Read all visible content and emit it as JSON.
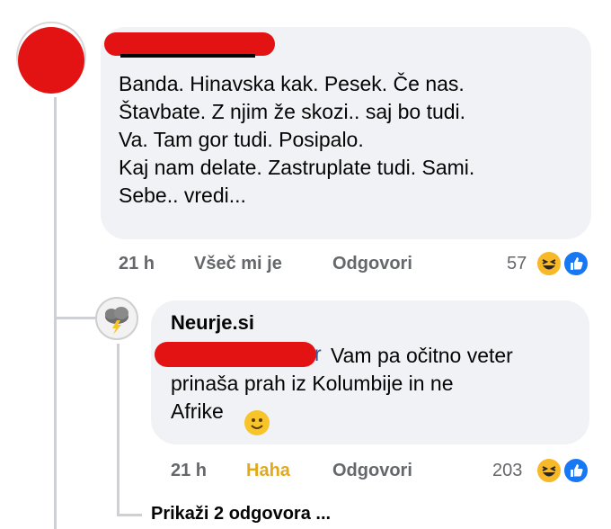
{
  "comment": {
    "text": "Banda. Hinavska kak. Pesek. Če nas.\nŠtavbate. Z njim že skozi.. saj bo tudi.\nVa. Tam gor tudi. Posipalo.\n Kaj nam delate.  Zastruplate tudi. Sami.\nSebe..  vredi...",
    "time": "21 h",
    "like_label": "Všeč mi je",
    "reply_label": "Odgovori",
    "reaction_count": "57",
    "reaction_icons": [
      "haha-icon",
      "like-icon"
    ]
  },
  "reply": {
    "author": "Neurje.si",
    "mention_tail": "r",
    "text": "Vam pa očitno veter\nprinaša prah iz Kolumbije in ne\nAfrike",
    "time": "21 h",
    "reaction_label": "Haha",
    "reply_label": "Odgovori",
    "reaction_count": "203",
    "reaction_icons": [
      "haha-icon",
      "like-icon"
    ],
    "avatar_icon": "storm-cloud-icon"
  },
  "more_replies_label": "Prikaži 2 odgovora ...",
  "colors": {
    "haha": "#e4a81b",
    "link": "#385898",
    "meta": "#65676b",
    "bubble": "#f0f2f5"
  }
}
